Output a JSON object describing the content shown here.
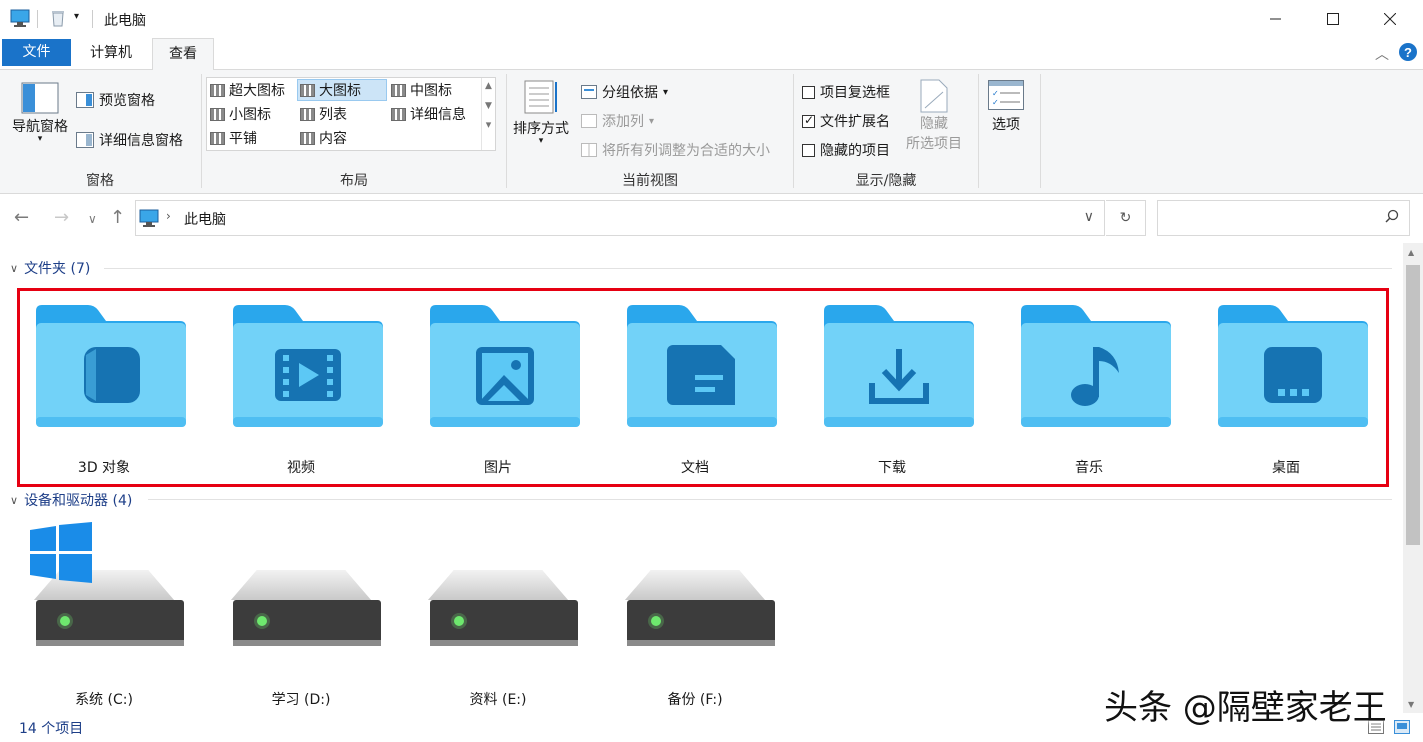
{
  "window": {
    "title": "此电脑"
  },
  "tabs": {
    "file": "文件",
    "computer": "计算机",
    "view": "查看"
  },
  "ribbon": {
    "panes": {
      "label": "窗格",
      "nav_pane": "导航窗格",
      "preview_pane": "预览窗格",
      "details_pane": "详细信息窗格"
    },
    "layout": {
      "label": "布局",
      "items": [
        "超大图标",
        "大图标",
        "中图标",
        "小图标",
        "列表",
        "详细信息",
        "平铺",
        "内容"
      ],
      "selected": "大图标"
    },
    "current_view": {
      "label": "当前视图",
      "sort_by": "排序方式",
      "group_by": "分组依据",
      "add_column": "添加列",
      "fit_columns": "将所有列调整为合适的大小"
    },
    "show_hide": {
      "label": "显示/隐藏",
      "item_checkboxes": {
        "label": "项目复选框",
        "checked": false
      },
      "file_extensions": {
        "label": "文件扩展名",
        "checked": true
      },
      "hidden_items": {
        "label": "隐藏的项目",
        "checked": false
      },
      "hide_selected_1": "隐藏",
      "hide_selected_2": "所选项目"
    },
    "options": "选项"
  },
  "address": {
    "crumb": "此电脑"
  },
  "folders_section": {
    "header": "文件夹 (7)",
    "items": [
      {
        "name": "3D 对象",
        "icon": "3d-objects-icon"
      },
      {
        "name": "视频",
        "icon": "video-icon"
      },
      {
        "name": "图片",
        "icon": "picture-icon"
      },
      {
        "name": "文档",
        "icon": "document-icon"
      },
      {
        "name": "下载",
        "icon": "download-icon"
      },
      {
        "name": "音乐",
        "icon": "music-icon"
      },
      {
        "name": "桌面",
        "icon": "desktop-icon"
      }
    ]
  },
  "drives_section": {
    "header": "设备和驱动器 (4)",
    "items": [
      {
        "name": "系统 (C:)"
      },
      {
        "name": "学习 (D:)"
      },
      {
        "name": "资料 (E:)"
      },
      {
        "name": "备份 (F:)"
      }
    ]
  },
  "status": {
    "count": "14 个项目"
  },
  "watermark": "头条 @隔壁家老王",
  "colors": {
    "accent": "#1a73c9",
    "folder": "#5cc8f5",
    "folder_glyph": "#1673b2",
    "highlight": "#e60012"
  }
}
